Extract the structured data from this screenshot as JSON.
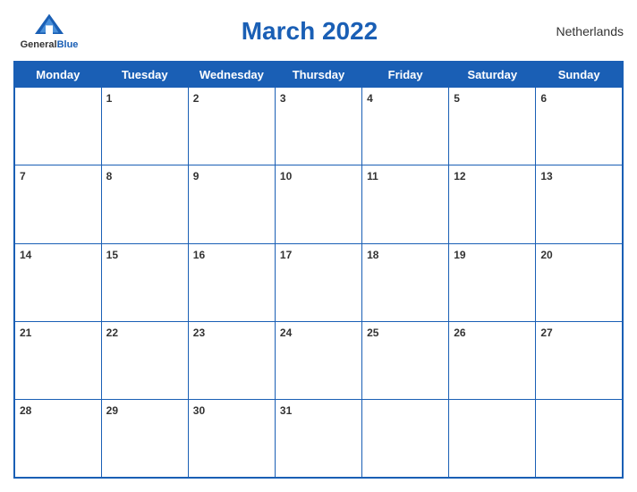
{
  "header": {
    "logo": {
      "general": "General",
      "blue": "Blue"
    },
    "title": "March 2022",
    "country": "Netherlands"
  },
  "weekdays": [
    "Monday",
    "Tuesday",
    "Wednesday",
    "Thursday",
    "Friday",
    "Saturday",
    "Sunday"
  ],
  "weeks": [
    [
      null,
      "1",
      "2",
      "3",
      "4",
      "5",
      "6"
    ],
    [
      "7",
      "8",
      "9",
      "10",
      "11",
      "12",
      "13"
    ],
    [
      "14",
      "15",
      "16",
      "17",
      "18",
      "19",
      "20"
    ],
    [
      "21",
      "22",
      "23",
      "24",
      "25",
      "26",
      "27"
    ],
    [
      "28",
      "29",
      "30",
      "31",
      null,
      null,
      null
    ]
  ]
}
